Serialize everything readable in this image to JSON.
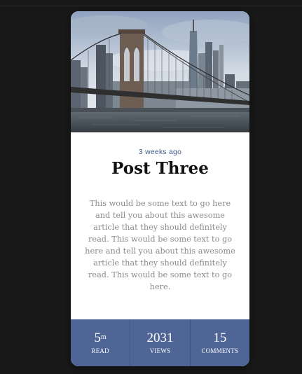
{
  "post": {
    "image_alt": "Brooklyn Bridge and Manhattan skyline",
    "date": "3 weeks ago",
    "title": "Post Three",
    "excerpt": "This would be some text to go here and tell you about this awesome article that they should definitely read. This would be some text to go here and tell you about this awesome article that they should definitely read. This would be some text to go here."
  },
  "stats": {
    "read": {
      "value": "5",
      "unit": "m",
      "label": "READ"
    },
    "views": {
      "value": "2031",
      "label": "VIEWS"
    },
    "comments": {
      "value": "15",
      "label": "COMMENTS"
    }
  },
  "colors": {
    "background": "#181818",
    "card": "#ffffff",
    "accent": "#4e6595",
    "date": "#3d5a8c",
    "excerpt": "#8a8a8a"
  }
}
